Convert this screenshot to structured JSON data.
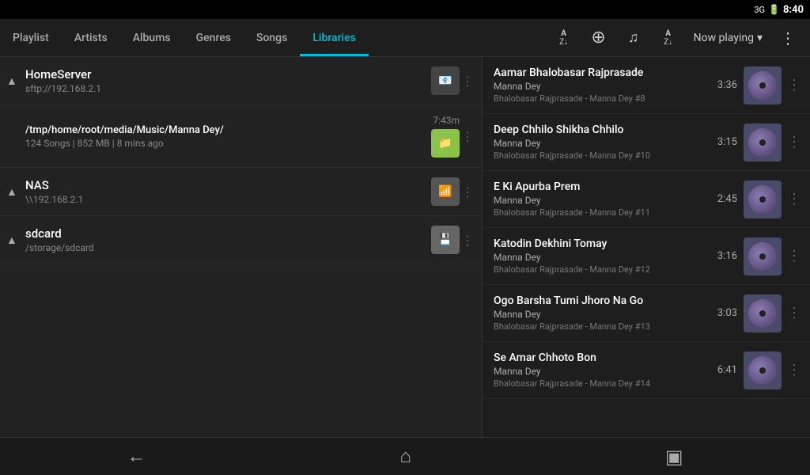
{
  "statusBar": {
    "signal": "3G",
    "battery": "🔋",
    "time": "8:40"
  },
  "tabs": [
    {
      "id": "playlist",
      "label": "Playlist",
      "active": false
    },
    {
      "id": "artists",
      "label": "Artists",
      "active": false
    },
    {
      "id": "albums",
      "label": "Albums",
      "active": false
    },
    {
      "id": "genres",
      "label": "Genres",
      "active": false
    },
    {
      "id": "songs",
      "label": "Songs",
      "active": false
    },
    {
      "id": "libraries",
      "label": "Libraries",
      "active": true
    }
  ],
  "toolbar": {
    "sortAZ1Label": "A-Z",
    "addLabel": "+",
    "nowPlayingLabel": "Now playing",
    "menuLabel": "⋮"
  },
  "libraries": [
    {
      "id": "homeserver",
      "name": "HomeServer",
      "sub": "sftp://192.168.2.1",
      "hasChevron": true,
      "iconType": "sftp",
      "time": null
    },
    {
      "id": "mannaDey",
      "name": "/tmp/home/root/media/Music/Manna Dey/",
      "sub": "124 Songs | 852 MB | 8 mins ago",
      "hasChevron": false,
      "iconType": "folder-ok",
      "time": "7:43m"
    },
    {
      "id": "nas",
      "name": "NAS",
      "sub": "\\\\192.168.2.1",
      "hasChevron": true,
      "iconType": "wifi",
      "time": null
    },
    {
      "id": "sdcard",
      "name": "sdcard",
      "sub": "/storage/sdcard",
      "hasChevron": true,
      "iconType": "sdcard",
      "time": null
    }
  ],
  "songs": [
    {
      "title": "Aamar Bhalobasar Rajprasade",
      "artist": "Manna Dey",
      "album": "Bhalobasar Rajprasade - Manna Dey #8",
      "duration": "3:36"
    },
    {
      "title": "Deep Chhilo Shikha Chhilo",
      "artist": "Manna Dey",
      "album": "Bhalobasar Rajprasade - Manna Dey #10",
      "duration": "3:15"
    },
    {
      "title": "E Ki Apurba Prem",
      "artist": "Manna Dey",
      "album": "Bhalobasar Rajprasade - Manna Dey #11",
      "duration": "2:45"
    },
    {
      "title": "Katodin Dekhini Tomay",
      "artist": "Manna Dey",
      "album": "Bhalobasar Rajprasade - Manna Dey #12",
      "duration": "3:16"
    },
    {
      "title": "Ogo Barsha Tumi Jhoro Na Go",
      "artist": "Manna Dey",
      "album": "Bhalobasar Rajprasade - Manna Dey #13",
      "duration": "3:03"
    },
    {
      "title": "Se Amar Chhoto Bon",
      "artist": "Manna Dey",
      "album": "Bhalobasar Rajprasade - Manna Dey #14",
      "duration": "6:41"
    }
  ],
  "playerControls": {
    "upLabel": "▲",
    "prevLabel": "⏮",
    "playLabel": "▶",
    "nextLabel": "⏭",
    "stopLabel": "⏹",
    "volumeLabel": "🔊"
  },
  "bottomNav": {
    "backLabel": "←",
    "homeLabel": "⌂",
    "recentLabel": "▣"
  }
}
